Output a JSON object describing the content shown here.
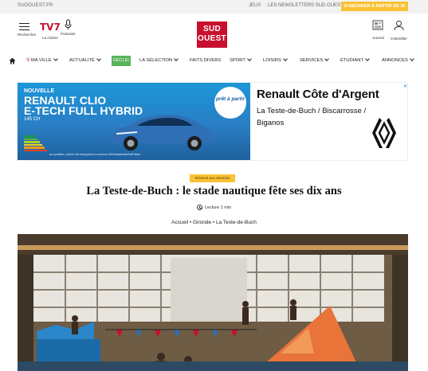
{
  "topbar": {
    "site": "SUDOUEST.FR",
    "links": [
      "JEUX",
      "LES NEWSLETTERS SUD OUEST"
    ],
    "subscribe": "S'ABONNER À PARTIR DE 1€"
  },
  "header": {
    "menu_label": "Rechercher",
    "tv7_logo": "TV7",
    "tv7_label": "La chaîne",
    "podcast_label": "Podcasts",
    "logo_line1": "SUD",
    "logo_line2": "OUEST",
    "journal_label": "Journal",
    "identify_label": "S'identifier"
  },
  "nav": {
    "items": [
      "MA VILLE",
      "ACTUALITÉ",
      "DÉCLIC",
      "LA SÉLECTION",
      "FAITS DIVERS",
      "SPORT",
      "LOISIRS",
      "SERVICES",
      "ÉTUDIANT",
      "ANNONCES"
    ]
  },
  "ad": {
    "line1": "NOUVELLE",
    "line2": "RENAULT CLIO",
    "line3": "E-TECH FULL HYBRID",
    "line4": "145 CH",
    "legal": "au quotidien, prenez les transports en commun #SeDéplacerMoinsPolluer",
    "badge": "prêt à partir",
    "title": "Renault Côte d'Argent",
    "sub1": "La Teste-de-Buch / Biscarrosse /",
    "sub2": "Biganos",
    "close": "✕",
    "colors": {
      "left_bg": "#1a8ad0",
      "car": "#2f6fb5"
    }
  },
  "article": {
    "tag": "Réservé aux abonnés",
    "title": "La Teste-de-Buch : le stade nautique fête ses dix ans",
    "reading_time": "Lecture 1 min",
    "breadcrumb": "Accueil • Gironde • La Teste-de-Buch"
  },
  "colors": {
    "brand_red": "#c8102e",
    "subscribe_yellow": "#f9c234",
    "declic_green": "#59b35a"
  }
}
